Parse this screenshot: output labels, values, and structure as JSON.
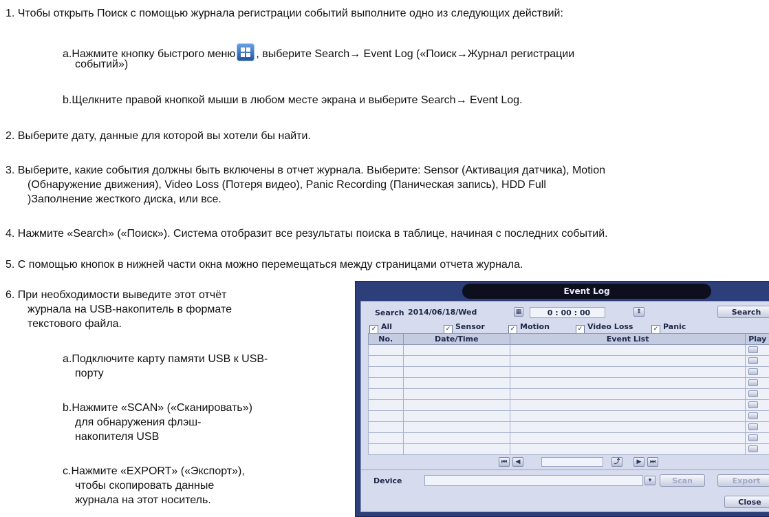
{
  "instructions": {
    "step1": "1. Чтобы открыть Поиск с помощью журнала регистрации событий выполните одно из следующих действий:",
    "step1a_before": "a.Нажмите кнопку быстрого меню",
    "step1a_after": ", выберите Search→ Event Log («Поиск→Журнал регистрации",
    "step1a_cont": "событий»)",
    "step1b": "b.Щелкните правой кнопкой мыши в любом месте экрана и выберите Search→ Event Log.",
    "step2": "2. Выберите дату, данные для которой вы хотели бы найти.",
    "step3_l1": "3. Выберите, какие события должны быть включены в отчет журнала. Выберите: Sensor (Активация датчика), Motion",
    "step3_l2": "(Обнаружение движения), Video Loss (Потеря видео), Panic Recording (Паническая запись), HDD Full",
    "step3_l3": ")Заполнение жесткого диска, или все.",
    "step4": "4. Нажмите «Search» («Поиск»). Система отобразит все результаты поиска в таблице, начиная с последних событий.",
    "step5": "5. С помощью кнопок в нижней части окна можно перемещаться между страницами отчета журнала.",
    "step6_l1": "6. При необходимости выведите этот отчёт",
    "step6_l2": "журнала на USB-накопитель в формате",
    "step6_l3": "текстового файла.",
    "step6a_l1": "a.Подключите карту памяти USB к USB-",
    "step6a_l2": "порту",
    "step6b_l1": "b.Нажмите «SCAN» («Сканировать»)",
    "step6b_l2": "для обнаружения флэш-",
    "step6b_l3": "накопителя USB",
    "step6c_l1": "c.Нажмите «EXPORT» («Экспорт»),",
    "step6c_l2": "чтобы скопировать данные",
    "step6c_l3": "журнала на этот носитель."
  },
  "event_log": {
    "title": "Event Log",
    "search_label": "Search",
    "date_value": "2014/06/18/Wed",
    "time_value": "0 : 00 : 00",
    "search_button": "Search",
    "checkboxes": {
      "all": "All",
      "sensor": "Sensor",
      "motion": "Motion",
      "video_loss": "Video Loss",
      "panic": "Panic"
    },
    "columns": {
      "no": "No.",
      "datetime": "Date/Time",
      "event_list": "Event List",
      "play": "Play"
    },
    "device_label": "Device",
    "scan_button": "Scan",
    "export_button": "Export",
    "close_button": "Close",
    "colors": {
      "frame": "#2c3f7a",
      "panel": "#d6dced",
      "title_bar": "#0d0f1c"
    }
  },
  "icons": {
    "quick_menu": "quick-menu-icon"
  }
}
